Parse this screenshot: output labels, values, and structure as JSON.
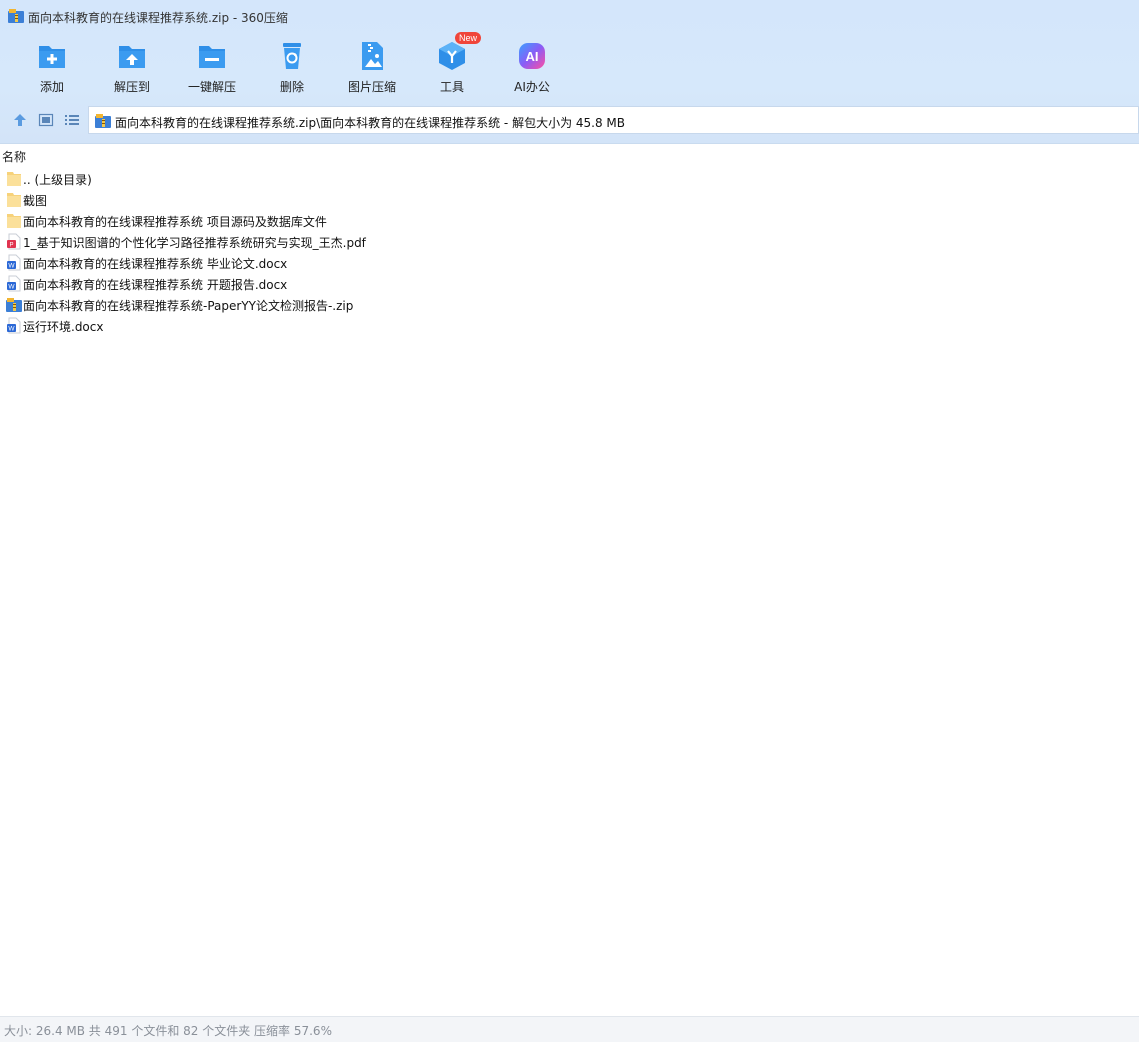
{
  "window": {
    "title": "面向本科教育的在线课程推荐系统.zip - 360压缩"
  },
  "toolbar": {
    "items": [
      {
        "label": "添加",
        "icon": "add-folder-icon"
      },
      {
        "label": "解压到",
        "icon": "extract-to-icon"
      },
      {
        "label": "一键解压",
        "icon": "one-click-extract-icon"
      },
      {
        "label": "删除",
        "icon": "recycle-delete-icon"
      },
      {
        "label": "图片压缩",
        "icon": "image-compress-icon"
      },
      {
        "label": "工具",
        "icon": "tools-cube-icon",
        "badge": "New"
      },
      {
        "label": "AI办公",
        "icon": "ai-office-icon"
      }
    ]
  },
  "address": {
    "path": "面向本科教育的在线课程推荐系统.zip\\面向本科教育的在线课程推荐系统 - 解包大小为 45.8 MB"
  },
  "columns": {
    "name": "名称"
  },
  "files": [
    {
      "name": ".. (上级目录)",
      "type": "folder"
    },
    {
      "name": "截图",
      "type": "folder"
    },
    {
      "name": "面向本科教育的在线课程推荐系统 项目源码及数据库文件",
      "type": "folder"
    },
    {
      "name": "1_基于知识图谱的个性化学习路径推荐系统研究与实现_王杰.pdf",
      "type": "pdf"
    },
    {
      "name": "面向本科教育的在线课程推荐系统 毕业论文.docx",
      "type": "docx"
    },
    {
      "name": "面向本科教育的在线课程推荐系统 开题报告.docx",
      "type": "docx"
    },
    {
      "name": "面向本科教育的在线课程推荐系统-PaperYY论文检测报告-.zip",
      "type": "zip"
    },
    {
      "name": "运行环境.docx",
      "type": "docx"
    }
  ],
  "status": {
    "text": "大小: 26.4 MB 共 491 个文件和 82 个文件夹 压缩率 57.6%"
  },
  "colors": {
    "accent": "#2f8fe8",
    "toolbar_bg": "#d4e6fb",
    "folder": "#f7d27a",
    "pdf": "#e0334f",
    "word": "#2b68d6"
  }
}
